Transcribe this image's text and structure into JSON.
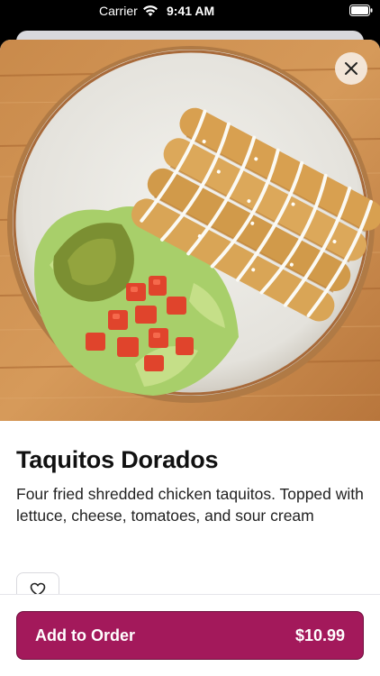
{
  "status_bar": {
    "carrier": "Carrier",
    "time": "9:41 AM",
    "wifi_icon": "wifi-icon",
    "battery_icon": "battery-icon"
  },
  "item": {
    "image_alt": "Taquitos Dorados plate",
    "title": "Taquitos Dorados",
    "description": "Four fried shredded chicken taquitos. Topped with lettuce, cheese, tomatoes, and sour cream"
  },
  "actions": {
    "close_icon": "close-icon",
    "favorite_icon": "heart-icon",
    "add_to_order_label": "Add to Order",
    "price": "$10.99"
  },
  "colors": {
    "accent": "#a3195b",
    "accent_border": "#6e0d3b",
    "background": "#ffffff",
    "text": "#111111"
  }
}
